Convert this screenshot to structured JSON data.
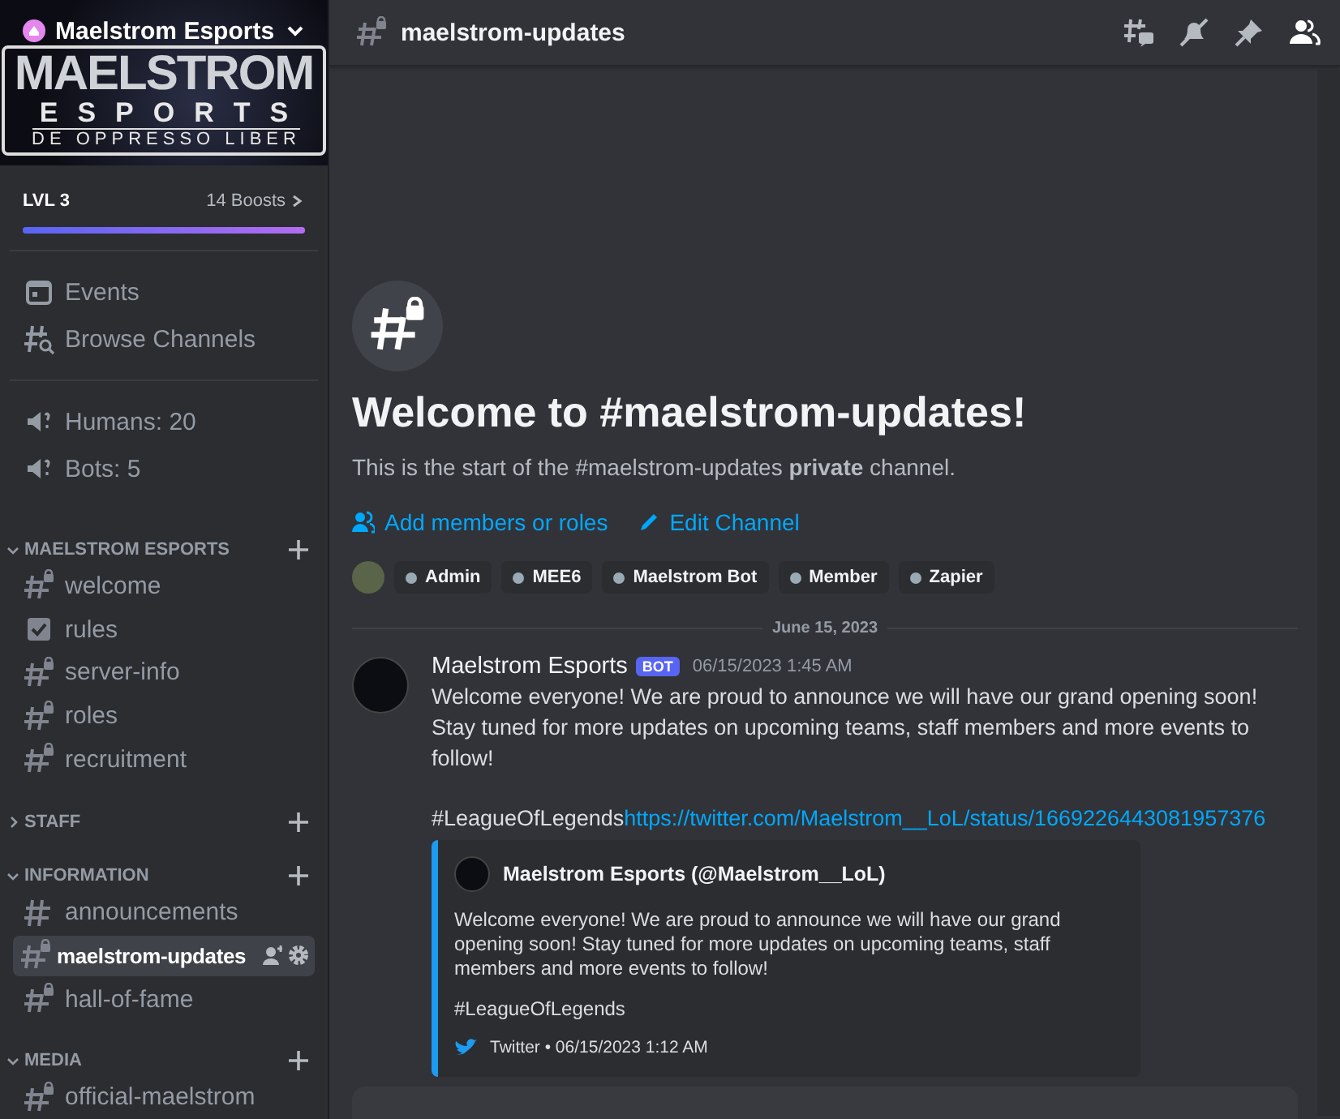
{
  "sidebar": {
    "server_name": "Maelstrom Esports",
    "banner": {
      "logo_lines": [
        "MAELSTROM",
        "ESPORTS",
        "DE OPPRESSO LIBER"
      ]
    },
    "boost": {
      "level_label": "LVL 3",
      "boosts": "14 Boosts",
      "level": 1
    },
    "items": [
      {
        "kind": "event",
        "label": "Events"
      },
      {
        "kind": "browse",
        "label": "Browse Channels"
      },
      {
        "kind": "stat",
        "label": "Humans: 20"
      },
      {
        "kind": "stat",
        "label": "Bots: 5"
      }
    ],
    "categories": [
      {
        "name": "MAELSTROM ESPORTS",
        "expanded": true,
        "channels": [
          {
            "name": "welcome",
            "kind": "private",
            "selected": false
          },
          {
            "name": "rules",
            "kind": "rules",
            "selected": false
          },
          {
            "name": "server-info",
            "kind": "private",
            "selected": false
          },
          {
            "name": "roles",
            "kind": "private",
            "selected": false
          },
          {
            "name": "recruitment",
            "kind": "private",
            "selected": false
          }
        ]
      },
      {
        "name": "STAFF",
        "expanded": false
      },
      {
        "name": "INFORMATION",
        "expanded": true,
        "channels": [
          {
            "name": "announcements",
            "kind": "text",
            "selected": false
          },
          {
            "name": "maelstrom-updates",
            "kind": "private",
            "selected": true
          },
          {
            "name": "hall-of-fame",
            "kind": "private",
            "selected": false
          }
        ]
      },
      {
        "name": "MEDIA",
        "expanded": true,
        "channels": [
          {
            "name": "official-maelstrom",
            "kind": "private",
            "selected": false
          }
        ]
      }
    ]
  },
  "header": {
    "channel": "maelstrom-updates"
  },
  "welcome": {
    "title": "Welcome to #maelstrom-updates!",
    "subtitle": "This is the start of the #maelstrom-updates **private** channel.",
    "actions": [
      {
        "kind": "members",
        "label": "Add members or roles"
      },
      {
        "kind": "edit",
        "label": "Edit Channel"
      }
    ],
    "roles": [
      "Admin",
      "MEE6",
      "Maelstrom Bot",
      "Member",
      "Zapier"
    ]
  },
  "date_divider": "June 15, 2023",
  "message": {
    "author": "Maelstrom Esports",
    "badge": "BOT",
    "time": "06/15/2023 1:45 AM",
    "text": "Welcome everyone! We are proud to announce we will have our grand opening soon! Stay tuned for more updates on upcoming teams, staff members and more events to follow!",
    "hashtag": "#LeagueOfLegends",
    "link": "https://twitter.com/Maelstrom__LoL/status/1669226443081957376",
    "embed": {
      "author": "Maelstrom Esports (@Maelstrom__LoL)",
      "text": "Welcome everyone! We are proud to announce we will have our grand opening soon! Stay tuned for more updates on upcoming teams, staff members and more events to follow!",
      "hashtag": "#LeagueOfLegends",
      "footer": "Twitter • 06/15/2023 1:12 AM"
    }
  }
}
